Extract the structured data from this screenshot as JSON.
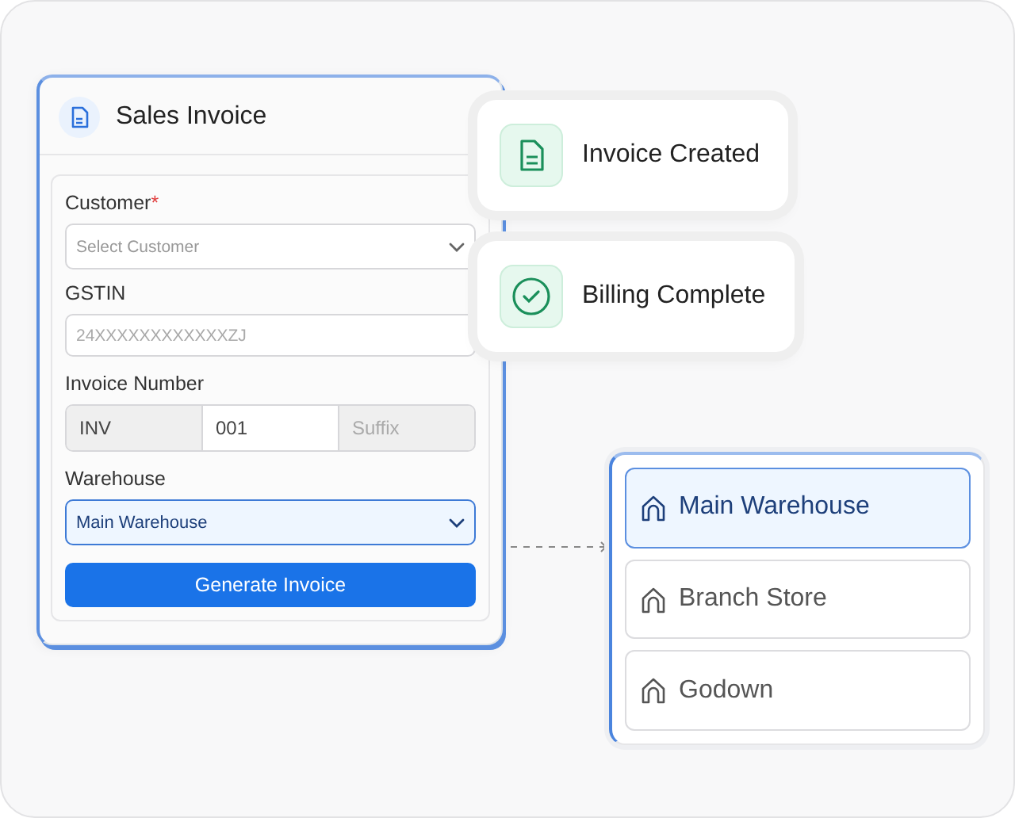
{
  "form": {
    "title": "Sales Invoice",
    "customer": {
      "label": "Customer",
      "required_mark": "*",
      "placeholder": "Select Customer"
    },
    "gstin": {
      "label": "GSTIN",
      "placeholder": "24XXXXXXXXXXXXZJ"
    },
    "invoice_number": {
      "label": "Invoice Number",
      "prefix": "INV",
      "number": "001",
      "suffix_placeholder": "Suffix"
    },
    "warehouse": {
      "label": "Warehouse",
      "value": "Main Warehouse"
    },
    "button": "Generate Invoice"
  },
  "notifications": [
    {
      "kind": "document",
      "text": "Invoice Created"
    },
    {
      "kind": "check",
      "text": "Billing Complete"
    }
  ],
  "warehouses": [
    {
      "name": "Main Warehouse",
      "selected": true
    },
    {
      "name": "Branch Store",
      "selected": false
    },
    {
      "name": "Godown",
      "selected": false
    }
  ]
}
